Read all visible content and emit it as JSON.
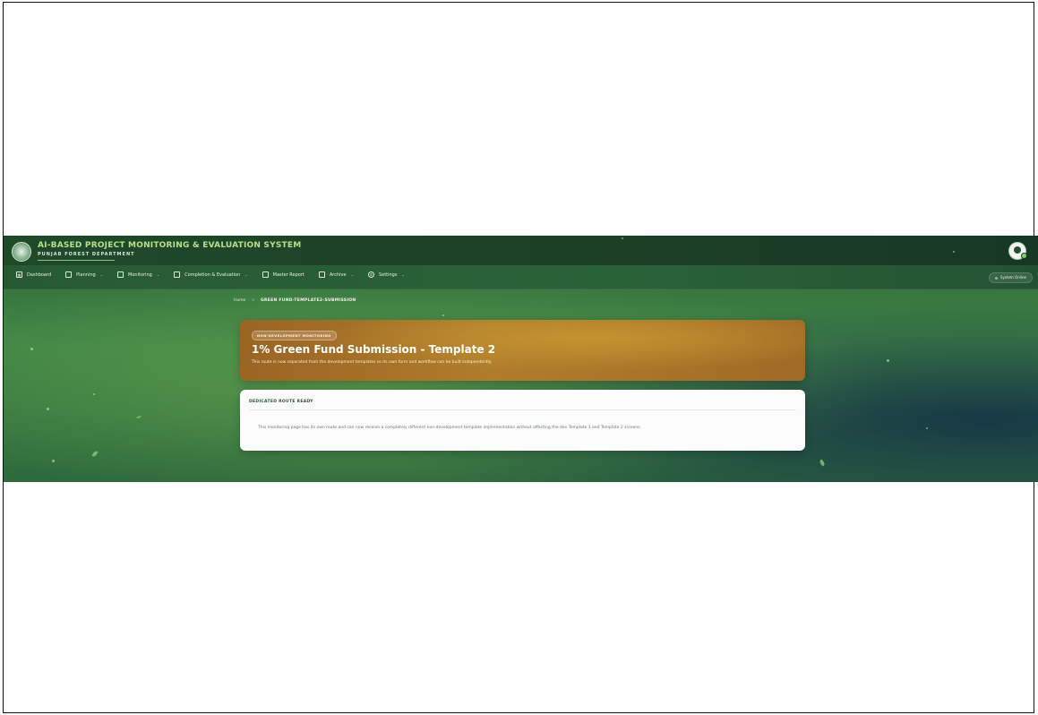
{
  "app": {
    "title_main": "AI-BASED PROJECT MONITORING & EVALUATION SYSTEM",
    "subtitle": "PUNJAB FOREST DEPARTMENT"
  },
  "nav": {
    "items": [
      {
        "label": "Dashboard",
        "icon": "grid-icon",
        "has_dropdown": false
      },
      {
        "label": "Planning",
        "icon": "clipboard-icon",
        "has_dropdown": true
      },
      {
        "label": "Monitoring",
        "icon": "monitor-icon",
        "has_dropdown": true
      },
      {
        "label": "Completion & Evaluation",
        "icon": "calendar-icon",
        "has_dropdown": true
      },
      {
        "label": "Master Report",
        "icon": "report-icon",
        "has_dropdown": false
      },
      {
        "label": "Archive",
        "icon": "archive-icon",
        "has_dropdown": true
      },
      {
        "label": "Settings",
        "icon": "gear-icon",
        "has_dropdown": true
      }
    ],
    "status": "System Online"
  },
  "breadcrumb": {
    "home": "Home",
    "separator": ">",
    "current": "GREEN FUND-TEMPLATE2-SUBMISSION"
  },
  "hero": {
    "badge": "NON-DEVELOPMENT MONITORING",
    "title": "1% Green Fund Submission - Template 2",
    "description": "This route is now separated from the development templates so its own form and workflow can be built independently."
  },
  "card": {
    "title": "DEDICATED ROUTE READY",
    "body": "This monitoring page has its own route and can now receive a completely different non-development template implementation without affecting the dev Template 1 and Template 2 screens."
  },
  "colors": {
    "brand_green": "#2f6a3a",
    "hero_gold": "#b07d2c",
    "status_green": "#7ed06b"
  }
}
